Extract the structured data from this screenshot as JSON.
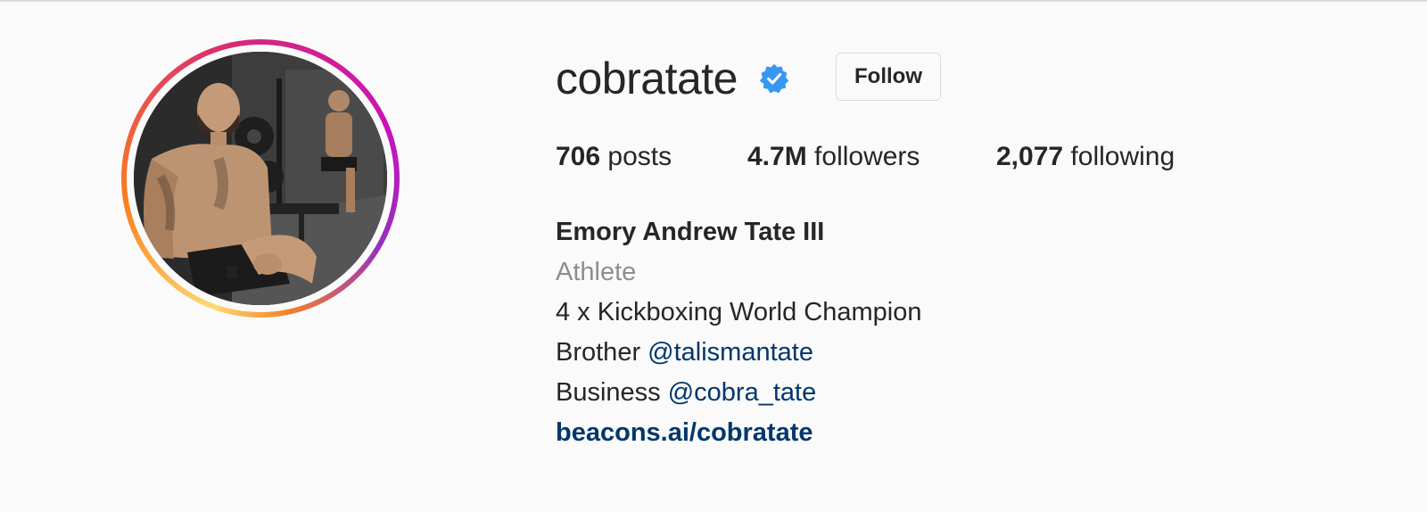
{
  "profile": {
    "username": "cobratate",
    "verified_icon": "verified-badge-icon",
    "follow_label": "Follow",
    "stats": {
      "posts_count": "706",
      "posts_label": "posts",
      "followers_count": "4.7M",
      "followers_label": "followers",
      "following_count": "2,077",
      "following_label": "following"
    },
    "full_name": "Emory Andrew Tate III",
    "category": "Athlete",
    "bio_line1": "4 x Kickboxing World Champion",
    "bio_line2_prefix": "Brother ",
    "bio_line2_mention": "@talismantate",
    "bio_line3_prefix": "Business ",
    "bio_line3_mention": "@cobra_tate",
    "website": "beacons.ai/cobratate"
  },
  "colors": {
    "background": "#fafafa",
    "text": "#262626",
    "muted": "#8e8e8e",
    "link": "#00376b",
    "verified": "#3897f0",
    "border": "#dbdbdb"
  }
}
